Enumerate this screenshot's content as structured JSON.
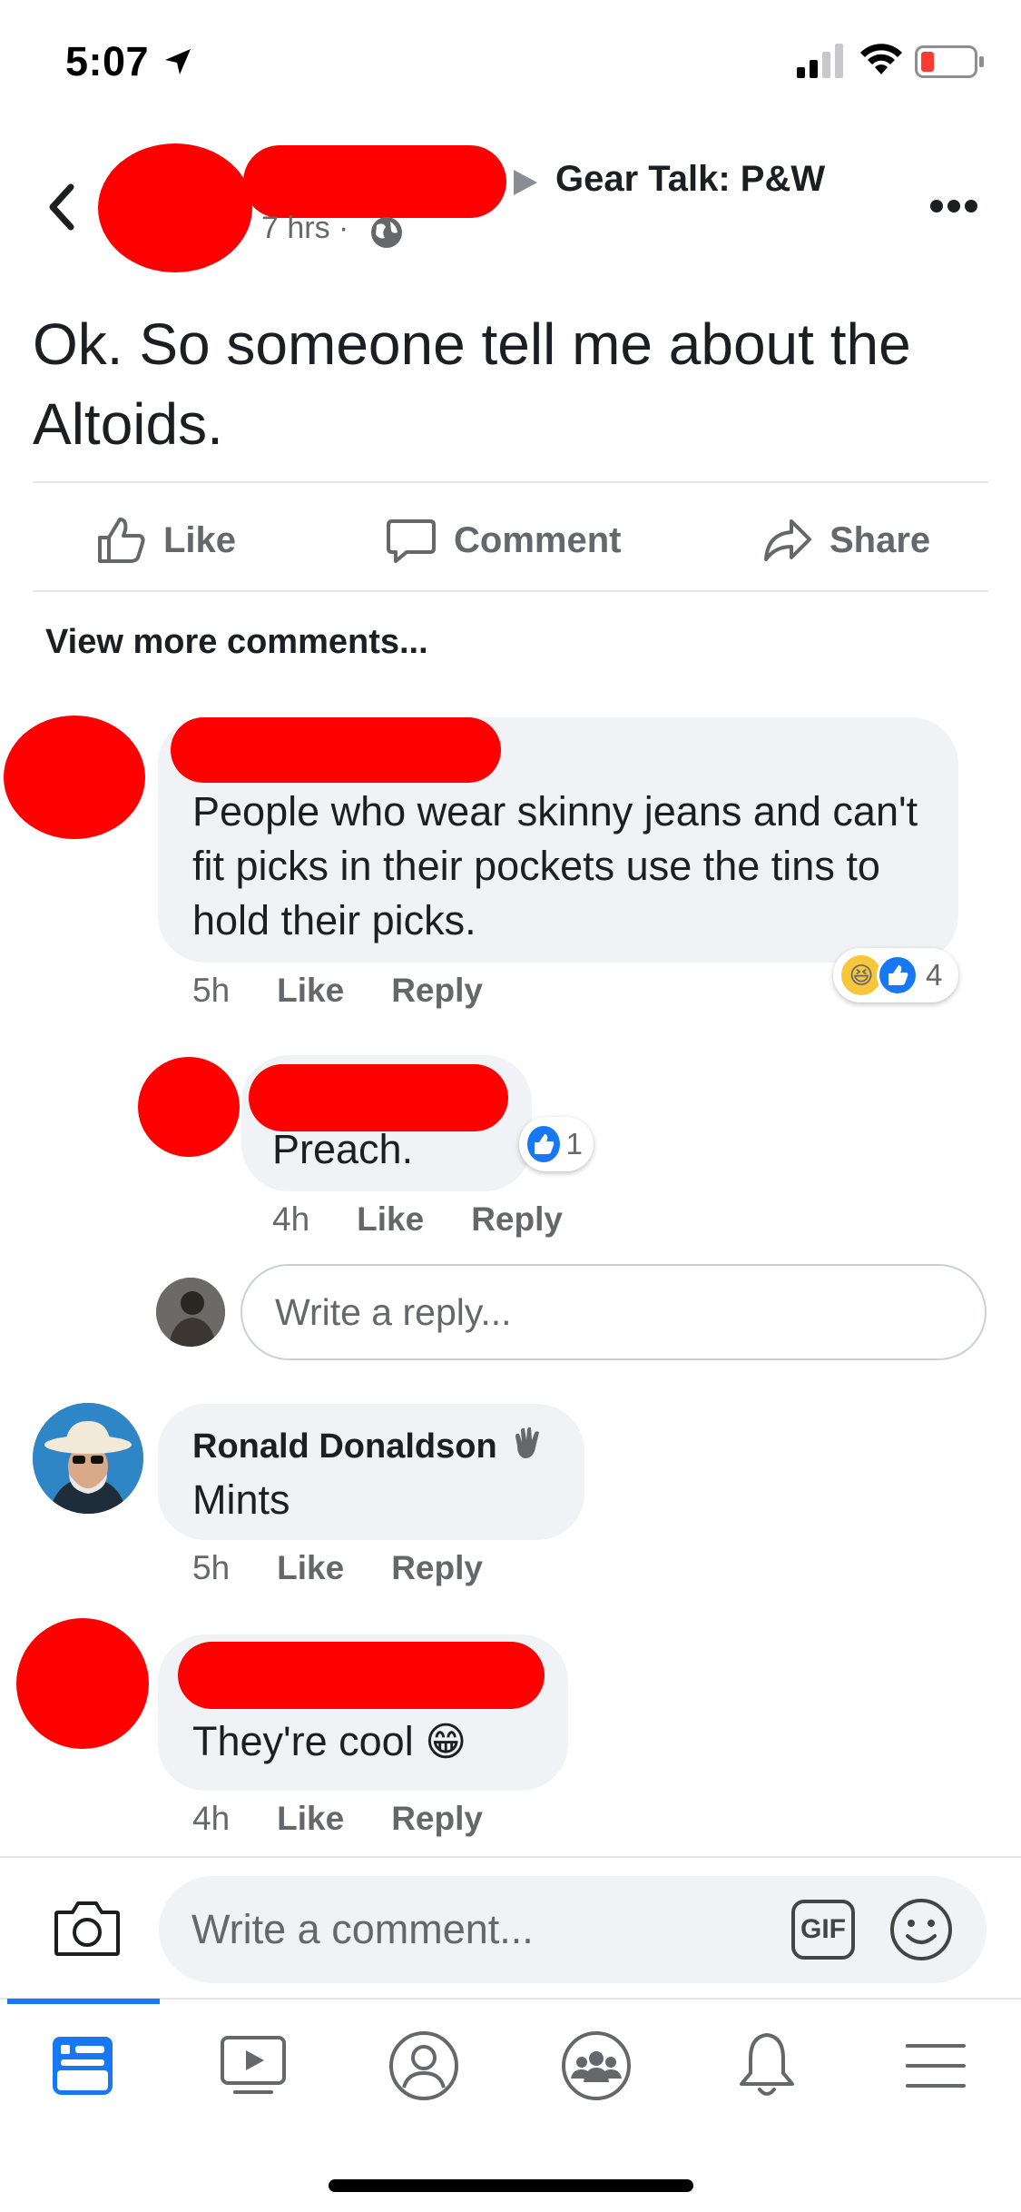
{
  "status_bar": {
    "time": "5:07"
  },
  "post": {
    "group": "Gear Talk: P&W",
    "time": "7 hrs",
    "text": "Ok. So someone tell me about the Altoids.",
    "actions": {
      "like": "Like",
      "comment": "Comment",
      "share": "Share"
    },
    "view_more": "View more comments..."
  },
  "comments": [
    {
      "text": "People who wear skinny jeans and can't fit picks in their pockets use the tins to hold their picks.",
      "time": "5h",
      "like": "Like",
      "reply": "Reply",
      "reaction_count": "4"
    },
    {
      "text": "Preach.",
      "time": "4h",
      "like": "Like",
      "reply": "Reply",
      "reaction_count": "1",
      "reply_placeholder": "Write a reply..."
    },
    {
      "name": "Ronald Donaldson",
      "text": "Mints",
      "time": "5h",
      "like": "Like",
      "reply": "Reply"
    },
    {
      "text": "They're cool",
      "emoji": "😁",
      "time": "4h",
      "like": "Like",
      "reply": "Reply"
    }
  ],
  "composer": {
    "placeholder": "Write a comment...",
    "gif_label": "GIF"
  },
  "icons": [
    "back-chevron-icon",
    "globe-icon",
    "more-icon",
    "camera-icon",
    "gif-icon",
    "emoji-icon",
    "news-feed-icon",
    "watch-icon",
    "profile-icon",
    "groups-icon",
    "notifications-icon",
    "menu-icon"
  ],
  "colors": {
    "accent": "#1877f2",
    "text": "#1c1e21",
    "secondary": "#65676b",
    "bubble": "#f0f2f5",
    "redaction": "#ff0000"
  }
}
